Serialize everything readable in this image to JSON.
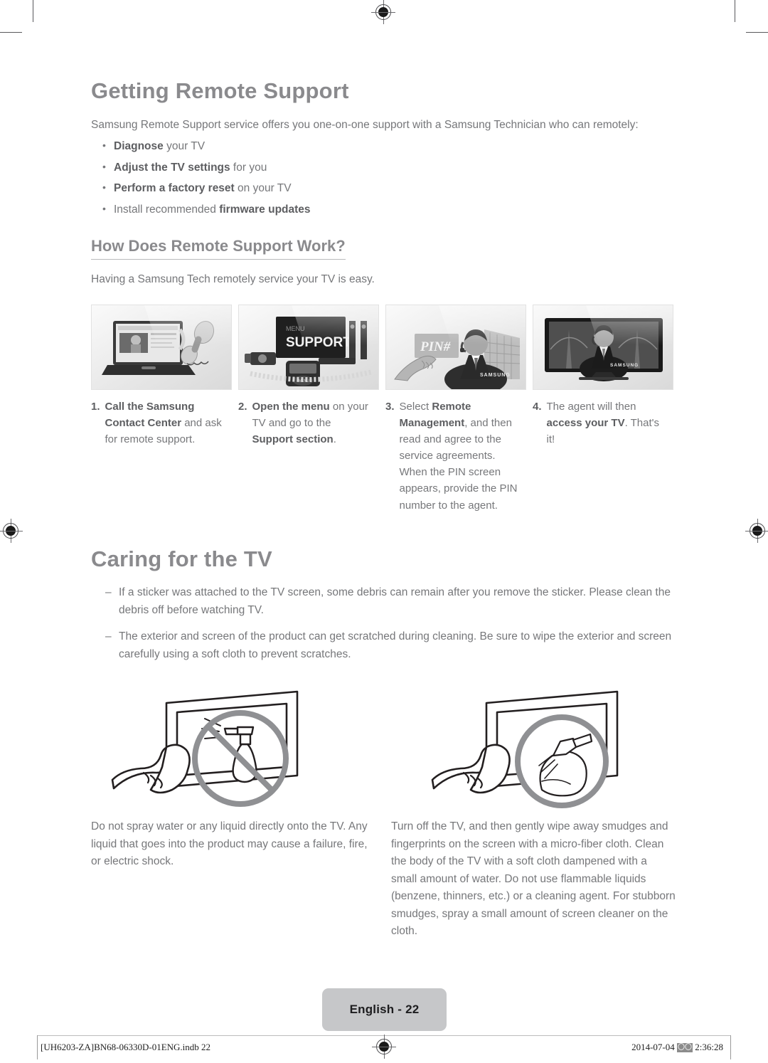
{
  "page": {
    "language_badge": "English - 22",
    "footer_left": "[UH6203-ZA]BN68-06330D-01ENG.indb   22",
    "footer_date": "2014-07-04",
    "footer_glyph": "〇〇",
    "footer_time": "2:36:28"
  },
  "remote_support": {
    "heading": "Getting Remote Support",
    "intro": "Samsung Remote Support service offers you one-on-one support with a Samsung Technician who can remotely:",
    "bullets": [
      {
        "bold": "Diagnose",
        "rest": " your TV",
        "bold_first": true
      },
      {
        "bold": "Adjust the TV settings",
        "rest": " for you",
        "bold_first": true
      },
      {
        "bold": "Perform a factory reset",
        "rest": " on your TV",
        "bold_first": true
      },
      {
        "lead": "Install recommended ",
        "bold": "firmware updates",
        "bold_first": false
      }
    ]
  },
  "how_it_works": {
    "heading": "How Does Remote Support Work?",
    "intro": "Having a Samsung Tech remotely service your TV is easy.",
    "steps": [
      {
        "number": "1.",
        "image_name": "laptop-and-phone-handset-illustration",
        "text_parts": [
          {
            "text": "Call the Samsung Contact Center",
            "bold": true
          },
          {
            "text": " and ask for remote support.",
            "bold": false
          }
        ]
      },
      {
        "number": "2.",
        "image_name": "tv-menu-support-illustration",
        "text_parts": [
          {
            "text": "Open the menu",
            "bold": true
          },
          {
            "text": " on your TV and go to the ",
            "bold": false
          },
          {
            "text": "Support section",
            "bold": true
          },
          {
            "text": ".",
            "bold": false
          }
        ]
      },
      {
        "number": "3.",
        "image_name": "pin-number-agent-illustration",
        "text_parts": [
          {
            "text": "Select ",
            "bold": false
          },
          {
            "text": "Remote Management",
            "bold": true
          },
          {
            "text": ", and then read and agree to the service agreements. When the PIN screen appears, provide the PIN number to the agent.",
            "bold": false
          }
        ]
      },
      {
        "number": "4.",
        "image_name": "agent-on-tv-screen-illustration",
        "text_parts": [
          {
            "text": "The agent will then ",
            "bold": false
          },
          {
            "text": "access your TV",
            "bold": true
          },
          {
            "text": ". That's it!",
            "bold": false
          }
        ]
      }
    ]
  },
  "caring": {
    "heading": "Caring for the TV",
    "notes": [
      "If a sticker was attached to the TV screen, some debris can remain after you remove the sticker. Please clean the debris off before watching TV.",
      "The exterior and screen of the product can get scratched during cleaning. Be sure to wipe the exterior and screen carefully using a soft cloth to prevent scratches."
    ],
    "figures": [
      {
        "image_name": "no-spray-on-tv-illustration",
        "caption": "Do not spray water or any liquid directly onto the TV. Any liquid that goes into the product may cause a failure, fire, or electric shock."
      },
      {
        "image_name": "spray-on-cloth-illustration",
        "caption": "Turn off the TV, and then gently wipe away smudges and fingerprints on the screen with a micro-fiber cloth. Clean the body of the TV with a soft cloth dampened with a small amount of water. Do not use flammable liquids (benzene, thinners, etc.) or a cleaning agent. For stubborn smudges, spray a small amount of screen cleaner on the cloth."
      }
    ]
  },
  "colors": {
    "body_text": "#76777a",
    "heading": "#8a8a8d",
    "bold_text": "#5d5e61",
    "badge_background": "#c6c7c9",
    "rule": "#b9babc"
  }
}
